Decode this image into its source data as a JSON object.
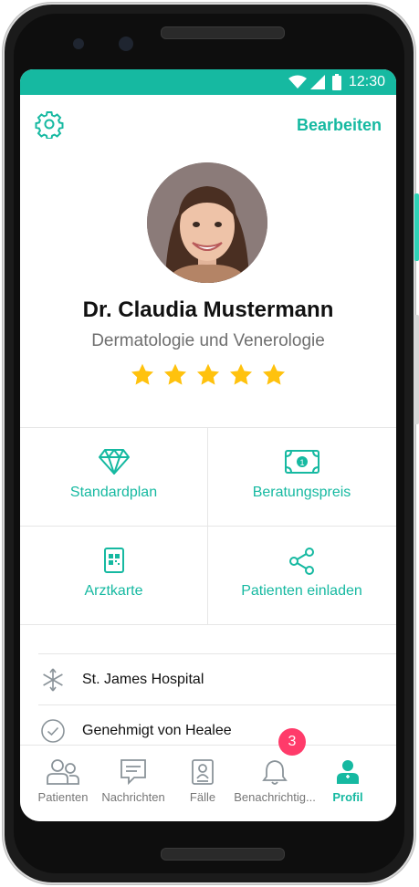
{
  "statusbar": {
    "time": "12:30"
  },
  "header": {
    "edit_label": "Bearbeiten",
    "icon": "gear-icon"
  },
  "profile": {
    "name": "Dr. Claudia Mustermann",
    "specialty": "Dermatologie und Venerologie",
    "rating": 5,
    "rating_max": 5
  },
  "actions": [
    {
      "label": "Standardplan",
      "icon": "diamond-icon"
    },
    {
      "label": "Beratungspreis",
      "icon": "banknote-icon"
    },
    {
      "label": "Arztkarte",
      "icon": "qr-card-icon"
    },
    {
      "label": "Patienten einladen",
      "icon": "share-icon"
    }
  ],
  "details": [
    {
      "text": "St. James Hospital",
      "icon": "medical-asterisk-icon"
    },
    {
      "text": "Genehmigt von Healee",
      "icon": "check-circle-icon"
    }
  ],
  "bottom_nav": {
    "items": [
      {
        "label": "Patienten",
        "icon": "patients-icon"
      },
      {
        "label": "Nachrichten",
        "icon": "messages-icon"
      },
      {
        "label": "Fälle",
        "icon": "cases-icon"
      },
      {
        "label": "Benachrichtig...",
        "icon": "bell-icon"
      },
      {
        "label": "Profil",
        "icon": "profile-icon",
        "active": true
      }
    ],
    "notification_badge": "3"
  },
  "colors": {
    "accent": "#16b9a1",
    "star": "#ffc20e",
    "badge": "#ff3b6a"
  }
}
